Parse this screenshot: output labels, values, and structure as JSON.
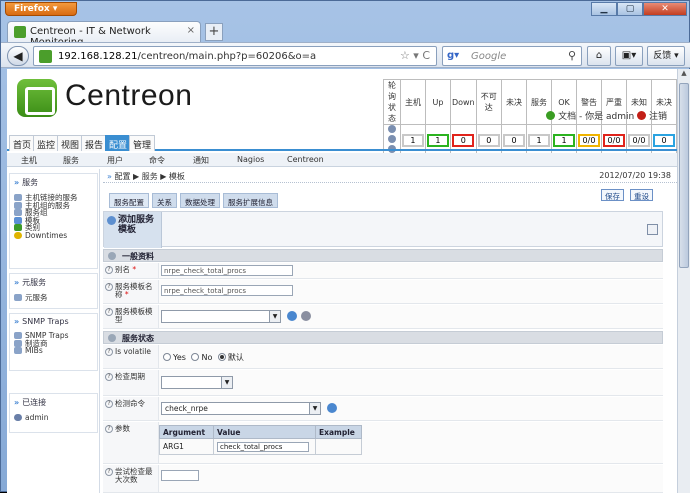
{
  "browser": {
    "app_button": "Firefox ▾",
    "tab_title": "Centreon - IT & Network Monitoring",
    "url_host": "192.168.128.21",
    "url_path": "/centreon/main.php?p=60206&o=a",
    "search_placeholder": "Google",
    "feedback_label": "反馈 ▾"
  },
  "header": {
    "logo_text": "Centreon",
    "status_groups": [
      {
        "label": "轮询状态"
      },
      {
        "label": "主机"
      },
      {
        "label": "Up",
        "value": "1",
        "color": "#2bb31f"
      },
      {
        "label": "Down",
        "value": "0",
        "color": "#e0231b"
      },
      {
        "label": "不可达",
        "value": "0",
        "color": "#c8c8c8"
      },
      {
        "label": "未决",
        "value": "0",
        "color": "#c8c8c8"
      },
      {
        "label": "服务",
        "value": "1",
        "color": "#c8c8c8"
      },
      {
        "label": "OK",
        "value": "1",
        "color": "#2bb31f"
      },
      {
        "label": "警告",
        "value": "0/0",
        "color": "#f0b400"
      },
      {
        "label": "严重",
        "value": "0/0",
        "color": "#e0231b"
      },
      {
        "label": "未知",
        "value": "0/0",
        "color": "#c8c8c8"
      },
      {
        "label": "未决",
        "value": "0",
        "color": "#2aa3e0"
      }
    ],
    "host_total": "1",
    "doc_link": "文档",
    "user_prefix": "- 你是",
    "username": "admin",
    "logout": "注销"
  },
  "main_menu": [
    "首页",
    "监控",
    "视图",
    "报告",
    "配置",
    "管理"
  ],
  "sub_menu": [
    "主机",
    "服务",
    "用户",
    "命令",
    "通知",
    "Nagios",
    "Centreon"
  ],
  "sidebar": {
    "section1": "服务",
    "items1": [
      "主机链接的服务",
      "主机组的服务",
      "服务组",
      "模板",
      "类别",
      "Downtimes"
    ],
    "section2": "元服务",
    "items2": [
      "元服务"
    ],
    "section3": "SNMP Traps",
    "items3": [
      "SNMP Traps",
      "制造商",
      "MIBs"
    ],
    "section4": "已连接",
    "items4": [
      "admin"
    ]
  },
  "breadcrumb": {
    "path": "配置 ▶ 服务 ▶ 模板",
    "datetime": "2012/07/20 19:38"
  },
  "tabs": [
    "服务配置",
    "关系",
    "数据处理",
    "服务扩展信息"
  ],
  "buttons": {
    "save": "保存",
    "reset": "重设"
  },
  "form": {
    "title": "添加服务模板",
    "section_general": "一般资料",
    "alias_label": "别名",
    "alias_value": "nrpe_check_total_procs",
    "name_label": "服务模板名称",
    "name_value": "nrpe_check_total_procs",
    "template_label": "服务模板模型",
    "section_state": "服务状态",
    "volatile_label": "Is volatile",
    "volatile_yes": "Yes",
    "volatile_no": "No",
    "volatile_default": "默认",
    "period_label": "检查周期",
    "command_label": "检测命令",
    "command_value": "check_nrpe",
    "args_label": "参数",
    "arg_headers": [
      "Argument",
      "Value",
      "Example"
    ],
    "arg_name": "ARG1",
    "arg_value": "check_total_procs",
    "max_attempts_label": "尝试检查最大次数"
  }
}
